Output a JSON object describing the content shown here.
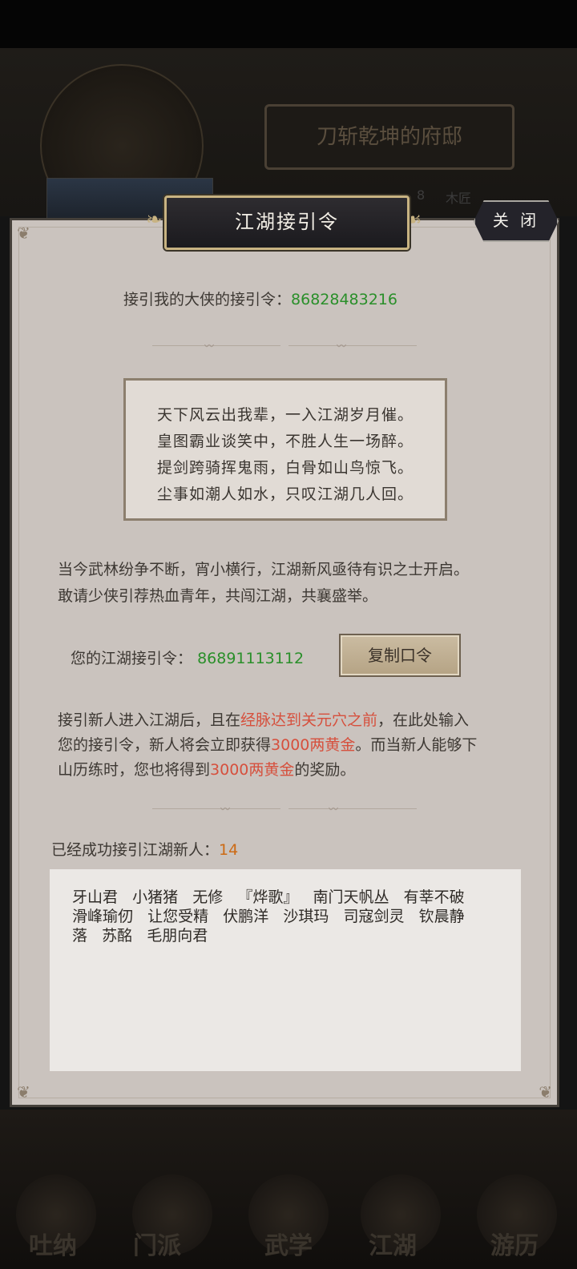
{
  "background": {
    "profile_name": "刀斩乾坤的府邸",
    "stat_partial_1": "8",
    "stat_partial_2": "木匠",
    "nav_items": [
      "吐纳",
      "门派",
      "武学",
      "江湖",
      "游历"
    ]
  },
  "dialog": {
    "title": "江湖接引令",
    "close_label": "关 闭",
    "inviter_label": "接引我的大侠的接引令：",
    "inviter_code": "86828483216",
    "poem": [
      "天下风云出我辈，一入江湖岁月催。",
      "皇图霸业谈笑中，不胜人生一场醉。",
      "提剑跨骑挥鬼雨，白骨如山鸟惊飞。",
      "尘事如潮人如水，只叹江湖几人回。"
    ],
    "intro_lines": [
      "当今武林纷争不断，宵小横行，江湖新风亟待有识之士开启。",
      "敢请少侠引荐热血青年，共闯江湖，共襄盛举。"
    ],
    "my_code_label": "您的江湖接引令：",
    "my_code": "86891113112",
    "copy_button": "复制口令",
    "rule": {
      "l1_a": "接引新人进入江湖后，且在",
      "l1_b": "经脉达到关元穴之前",
      "l1_c": "，在此处输入",
      "l2_a": "您的接引令，新人将会立即获得",
      "l2_b": "3000两黄金",
      "l2_c": "。而当新人能够下",
      "l3_a": "山历练时，您也将得到",
      "l3_b": "3000两黄金",
      "l3_c": "的奖励。"
    },
    "invited_label": "已经成功接引江湖新人：",
    "invited_count": "14",
    "invited_names": [
      "牙山君   小猪猪   无修   『烨歌』   南门天帆丛   有莘不破",
      "滑峰瑜仞   让您受精   伏鹏洋   沙琪玛   司寇剑灵   钦晨静",
      "落   苏酩   毛朋向君"
    ]
  },
  "colors": {
    "panel": "#cac3be",
    "code_green": "#2a8f2a",
    "highlight_red": "#d6503d",
    "count_orange": "#cc6a14",
    "title_gold": "#c8b382"
  }
}
